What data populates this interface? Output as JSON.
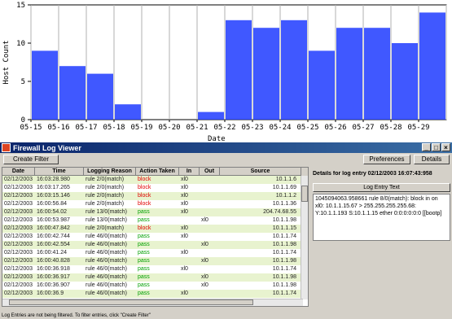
{
  "chart_data": {
    "type": "bar",
    "ylabel": "Host Count",
    "xlabel": "Date",
    "ylim": [
      0,
      15
    ],
    "yticks": [
      "0",
      "5",
      "10",
      "15"
    ],
    "categories": [
      "05-15",
      "05-16",
      "05-17",
      "05-18",
      "05-19",
      "05-20",
      "05-21",
      "05-22",
      "05-23",
      "05-24",
      "05-25",
      "05-26",
      "05-27",
      "05-28",
      "05-29"
    ],
    "series": [
      {
        "name": "",
        "values": [
          9,
          7,
          6,
          2,
          0,
          0,
          1,
          13,
          12,
          13,
          9,
          12,
          12,
          10,
          14
        ]
      }
    ],
    "grid": "vertical",
    "colors": {
      "bar": "#1f3bff",
      "bar_dark": "#00008b"
    }
  },
  "window": {
    "title": "Firewall Log Viewer",
    "buttons": {
      "minimize": "_",
      "maximize": "□",
      "close": "×"
    }
  },
  "toolbar": {
    "create_filter": "Create Filter",
    "preferences": "Preferences",
    "details": "Details"
  },
  "table": {
    "columns": [
      "Date",
      "Time",
      "Logging Reason",
      "Action Taken",
      "In",
      "Out",
      "Source"
    ],
    "rows": [
      [
        "02/12/2003",
        "16:03:28.980",
        "rule 2/0(match)",
        "block",
        "xl0",
        "",
        "10.1.1.6"
      ],
      [
        "02/12/2003",
        "16:03:17.265",
        "rule 2/0(match)",
        "block",
        "xl0",
        "",
        "10.1.1.69"
      ],
      [
        "02/12/2003",
        "16:03:15.146",
        "rule 2/0(match)",
        "block",
        "xl0",
        "",
        "10.1.1.2"
      ],
      [
        "02/12/2003",
        "16:00:56.84",
        "rule 2/0(match)",
        "block",
        "xl0",
        "",
        "10.1.1.36"
      ],
      [
        "02/12/2003",
        "16:00:54.02",
        "rule 13/0(match)",
        "pass",
        "xl0",
        "",
        "204.74.68.55"
      ],
      [
        "02/12/2003",
        "16:00:53.987",
        "rule 13/0(match)",
        "pass",
        "",
        "xl0",
        "10.1.1.98"
      ],
      [
        "02/12/2003",
        "16:00:47.842",
        "rule 2/0(match)",
        "block",
        "xl0",
        "",
        "10.1.1.15"
      ],
      [
        "02/12/2003",
        "16:00:42.744",
        "rule 46/0(match)",
        "pass",
        "xl0",
        "",
        "10.1.1.74"
      ],
      [
        "02/12/2003",
        "16:00:42.554",
        "rule 46/0(match)",
        "pass",
        "",
        "xl0",
        "10.1.1.98"
      ],
      [
        "02/12/2003",
        "16:00:41.24",
        "rule 46/0(match)",
        "pass",
        "xl0",
        "",
        "10.1.1.74"
      ],
      [
        "02/12/2003",
        "16:00:40.828",
        "rule 46/0(match)",
        "pass",
        "",
        "xl0",
        "10.1.1.98"
      ],
      [
        "02/12/2003",
        "16:00:36.918",
        "rule 46/0(match)",
        "pass",
        "xl0",
        "",
        "10.1.1.74"
      ],
      [
        "02/12/2003",
        "16:00:36.917",
        "rule 46/0(match)",
        "pass",
        "",
        "xl0",
        "10.1.1.98"
      ],
      [
        "02/12/2003",
        "16:00:36.907",
        "rule 46/0(match)",
        "pass",
        "",
        "xl0",
        "10.1.1.98"
      ],
      [
        "02/12/2003",
        "16:00:36.9",
        "rule 46/0(match)",
        "pass",
        "xl0",
        "",
        "10.1.1.74"
      ]
    ]
  },
  "details": {
    "title": "Details for log entry 02/12/2003 16:07:43:958",
    "section_label": "Log Entry Text",
    "text": "1045094063.958661 rule 8/0(match): block in on xl0: 10.1.1.15.67 > 255.255.255.255.68: Y:10.1.1.193 S:10.1.1.15 ether 0:0:0:0:0:0 [[bootp]"
  },
  "status": "Log Entries are not being filtered. To filter entries, click \"Create Filter\"",
  "colors": {
    "row_alt": "#e8f3cf",
    "block": "#e00000",
    "pass": "#00a000",
    "titlebar": "#0a246a"
  }
}
